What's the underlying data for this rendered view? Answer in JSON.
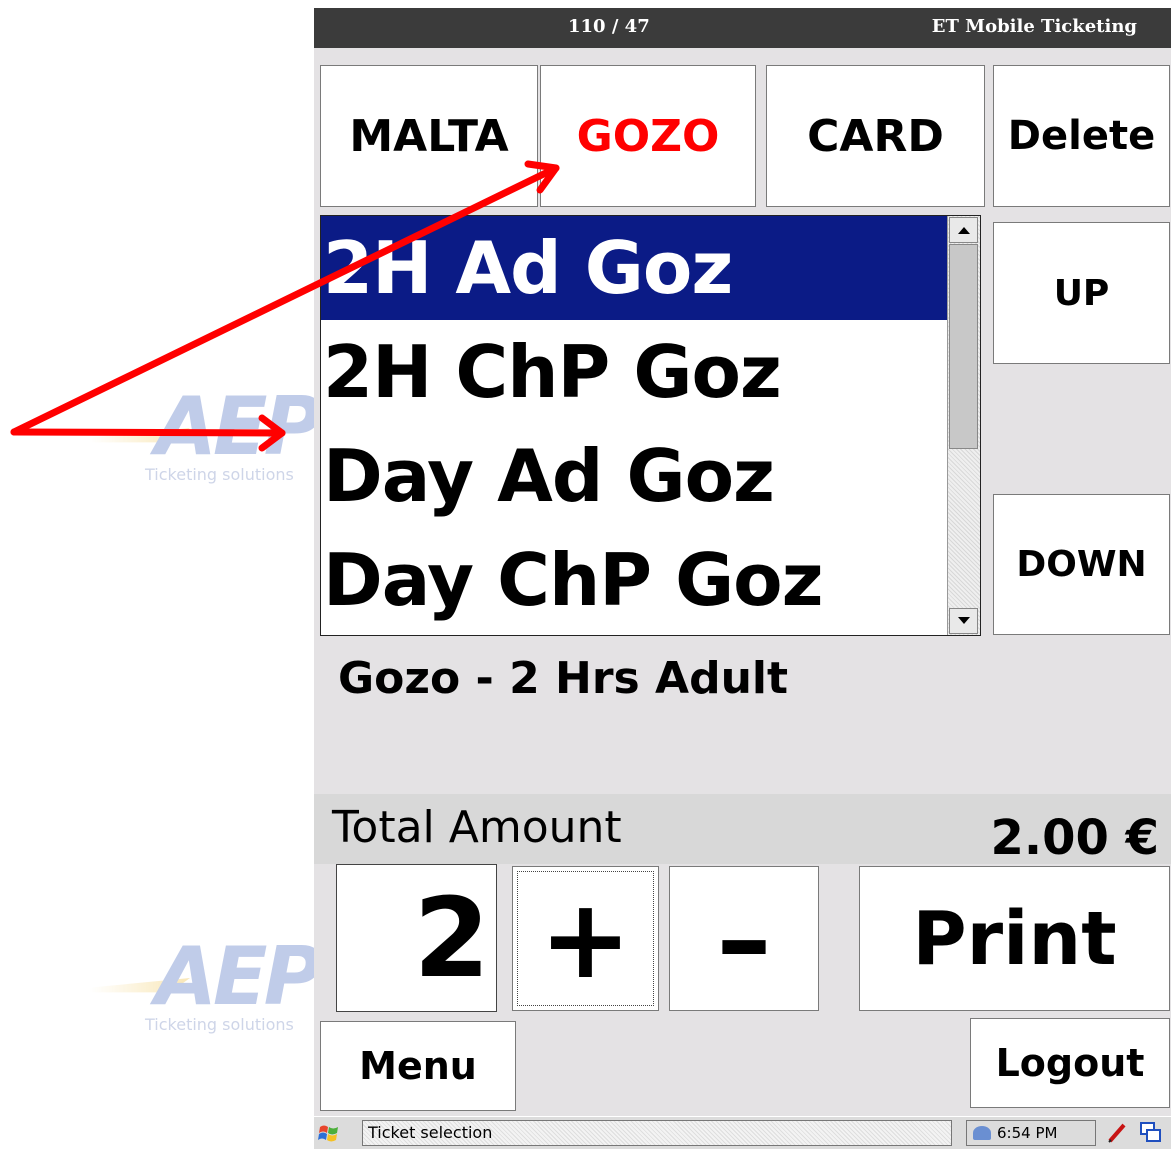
{
  "title_bar": {
    "counter": "110 / 47",
    "app_name": "ET Mobile Ticketing"
  },
  "zones": [
    "MALTA",
    "GOZO",
    "CARD"
  ],
  "active_zone": "GOZO",
  "buttons": {
    "delete": "Delete",
    "up": "UP",
    "down": "DOWN",
    "plus": "+",
    "minus": "–",
    "print": "Print",
    "menu": "Menu",
    "logout": "Logout"
  },
  "tickets": [
    "2H Ad Goz",
    "2H ChP Goz",
    "Day Ad Goz",
    "Day ChP Goz"
  ],
  "selected_ticket": "2H Ad Goz",
  "description": "Gozo - 2 Hrs Adult",
  "total": {
    "label": "Total Amount",
    "amount": "2.00 €"
  },
  "quantity": "2",
  "status_bar": {
    "task": "Ticket selection",
    "time": "6:54 PM"
  },
  "watermark": {
    "logo_text": "AEP",
    "tagline": "Ticketing solutions"
  },
  "colors": {
    "selection": "#0b1b86",
    "active_zone": "#ff0000",
    "annotation_arrow": "#ff0000"
  }
}
